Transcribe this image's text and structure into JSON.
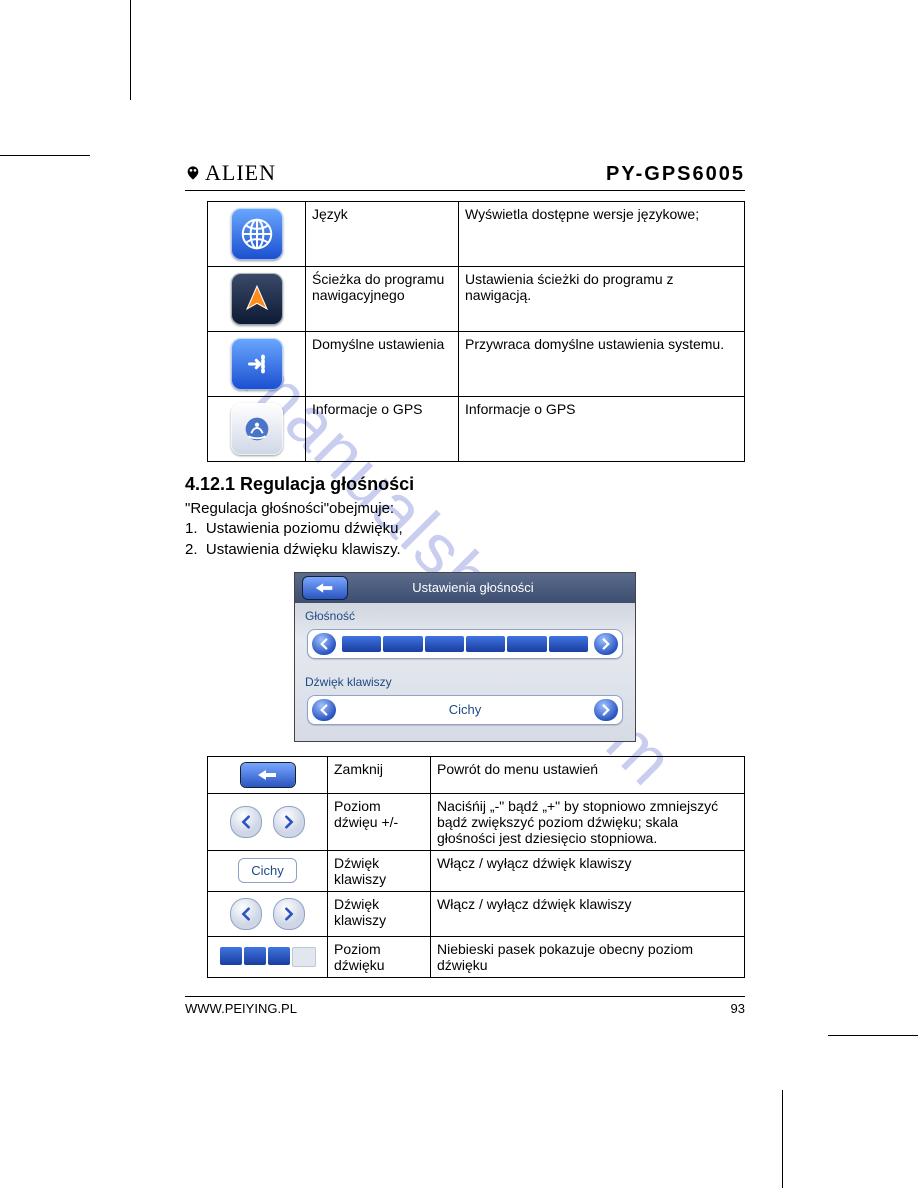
{
  "header": {
    "brand": "ALIEN",
    "model": "PY-GPS6005"
  },
  "settings_table": [
    {
      "icon": "globe-icon",
      "name": "Język",
      "desc": "Wyświetla dostępne wersje językowe;"
    },
    {
      "icon": "arrow-nav-icon",
      "name": "Ścieżka do programu nawigacyjnego",
      "desc": "Ustawienia ścieżki do programu z nawigacją."
    },
    {
      "icon": "reset-icon",
      "name": "Domyślne ustawienia",
      "desc": "Przywraca domyślne ustawienia systemu."
    },
    {
      "icon": "gps-info-icon",
      "name": "Informacje o GPS",
      "desc": "Informacje o GPS"
    }
  ],
  "section": {
    "number_title": "4.12.1  Regulacja głośności",
    "intro": "\"Regulacja głośności\"obejmuje:",
    "items": [
      "Ustawienia poziomu dźwięku,",
      "Ustawienia dźwięku klawiszy."
    ]
  },
  "screenshot": {
    "title": "Ustawienia głośności",
    "label_volume": "Głośność",
    "label_keysound": "Dźwięk klawiszy",
    "keysound_value": "Cichy",
    "volume_bars_on": 6,
    "volume_bars_total": 6
  },
  "controls_table": [
    {
      "icon": "back-icon",
      "name": "Zamknij",
      "desc": "Powrót do menu ustawień"
    },
    {
      "icon": "pm-buttons",
      "name": "Poziom dźwięu +/-",
      "desc": "Naciśńij „-\" bądź „+\" by stopniowo zmniejszyć bądź zwiększyć poziom dźwięku; skala głośności jest dziesięcio stopniowa."
    },
    {
      "icon": "cichy-box",
      "name": "Dźwięk klawiszy",
      "desc": "Włącz / wyłącz dźwięk klawiszy"
    },
    {
      "icon": "lr-buttons",
      "name": "Dźwięk klawiszy",
      "desc": "Włącz / wyłącz dźwięk klawiszy"
    },
    {
      "icon": "level-bars",
      "name": "Poziom dźwięku",
      "desc": "Niebieski pasek pokazuje obecny poziom dźwięku"
    }
  ],
  "footer": {
    "url": "WWW.PEIYING.PL",
    "page": "93"
  },
  "watermark": "manualshive.com"
}
